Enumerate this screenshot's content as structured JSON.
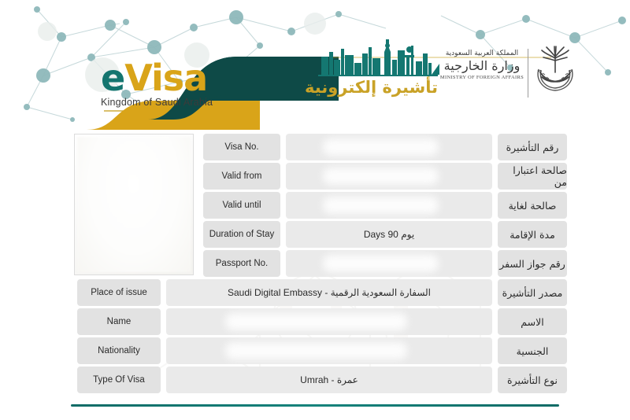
{
  "document": {
    "title": "eVisa - Kingdom of Saudi Arabia",
    "type": "saudi-evisa"
  },
  "header": {
    "logo": {
      "letter_e": "e",
      "word_visa": "Visa",
      "subtitle": "Kingdom of Saudi Arabia"
    },
    "skyline_icon": "riyadh-skyline-icon",
    "arabic_visa_title": "تأشيرة إلكترونية",
    "mofa": {
      "arabic_line1": "المملكة العربية السعودية",
      "arabic_line2": "وزارة الخارجية",
      "english": "MINISTRY OF FOREIGN AFFAIRS"
    },
    "emblem_icon": "saudi-emblem-icon"
  },
  "photo": {
    "alt": "applicant-photo",
    "redacted": true
  },
  "fields": [
    {
      "key": "visa_no",
      "en_label": "Visa No.",
      "ar_label": "رقم التأشيرة",
      "value": "",
      "redacted": true,
      "width": "short"
    },
    {
      "key": "valid_from",
      "en_label": "Valid from",
      "ar_label": "صالحة اعتبارا من",
      "value": "",
      "redacted": true,
      "width": "short"
    },
    {
      "key": "valid_until",
      "en_label": "Valid until",
      "ar_label": "صالحة لغاية",
      "value": "",
      "redacted": true,
      "width": "short"
    },
    {
      "key": "duration_of_stay",
      "en_label": "Duration of Stay",
      "ar_label": "مدة الإقامة",
      "value": "Days 90 يوم",
      "redacted": false,
      "width": "short"
    },
    {
      "key": "passport_no",
      "en_label": "Passport No.",
      "ar_label": "رقم جواز السفر",
      "value": "",
      "redacted": true,
      "width": "short"
    },
    {
      "key": "place_of_issue",
      "en_label": "Place of issue",
      "ar_label": "مصدر التأشيرة",
      "value": "Saudi Digital Embassy - السفارة السعودية الرقمية",
      "redacted": false,
      "width": "full"
    },
    {
      "key": "name",
      "en_label": "Name",
      "ar_label": "الاسم",
      "value": "",
      "redacted": true,
      "width": "full"
    },
    {
      "key": "nationality",
      "en_label": "Nationality",
      "ar_label": "الجنسية",
      "value": "",
      "redacted": true,
      "width": "full"
    },
    {
      "key": "type_of_visa",
      "en_label": "Type Of Visa",
      "ar_label": "نوع التأشيرة",
      "value": "Umrah - عمرة",
      "redacted": false,
      "width": "full"
    }
  ],
  "colors": {
    "teal_dark": "#0e4a47",
    "teal": "#14756f",
    "gold": "#d9a419",
    "gold_title": "#c9a227",
    "cell_label_bg": "#e2e2e2",
    "cell_value_bg": "#eaeaea",
    "network_node": "#7fb0b2"
  }
}
